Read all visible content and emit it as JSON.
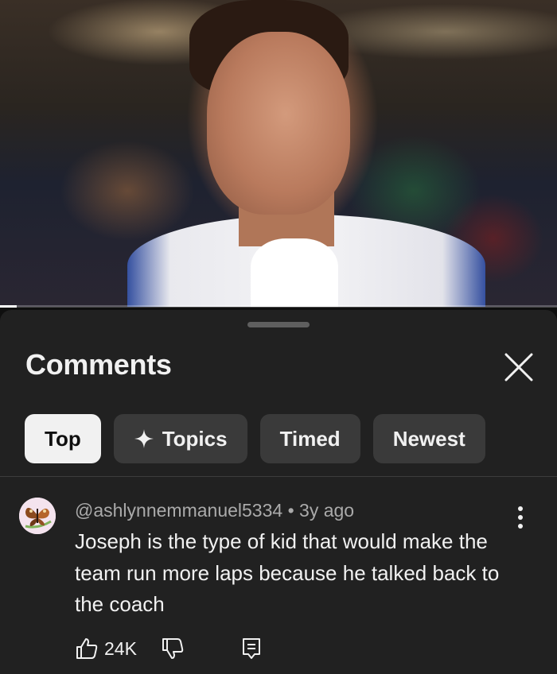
{
  "video": {
    "progress_fraction": 0.03
  },
  "comments_panel": {
    "title": "Comments",
    "close_icon": "close-icon",
    "filters": [
      {
        "label": "Top",
        "active": true
      },
      {
        "label": "Topics",
        "icon": "sparkle-icon",
        "active": false
      },
      {
        "label": "Timed",
        "active": false
      },
      {
        "label": "Newest",
        "active": false
      }
    ]
  },
  "comment": {
    "author": "@ashlynnemmanuel5334",
    "separator": " • ",
    "time_ago": "3y ago",
    "text": "Joseph is the type of kid that would make the team run more laps because he talked back to the coach",
    "like_count": "24K",
    "icons": [
      "thumbs-up-icon",
      "thumbs-down-icon",
      "reply-icon",
      "more-vert-icon"
    ]
  },
  "colors": {
    "background": "#0f0f0f",
    "sheet": "#212121",
    "chip": "#3a3a3a",
    "chip_active": "#f1f1f1",
    "secondary_text": "#aaaaaa"
  }
}
